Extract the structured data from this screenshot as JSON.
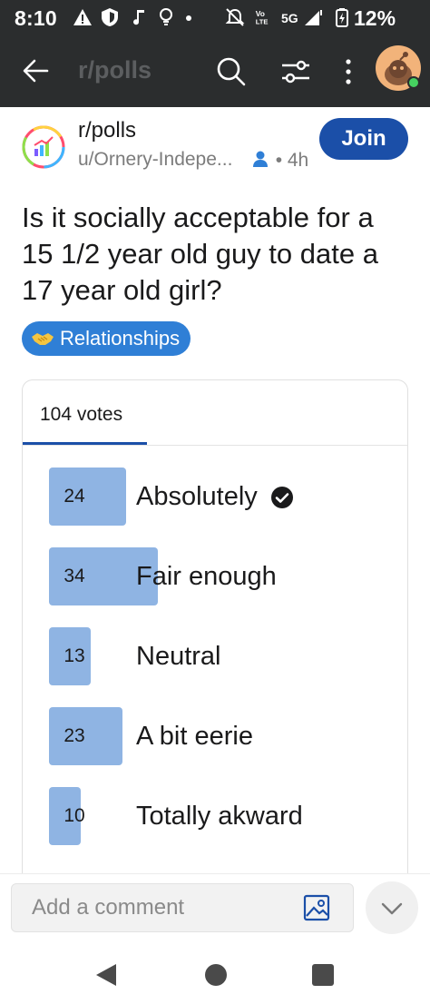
{
  "status_bar": {
    "time": "8:10",
    "network": "5G",
    "battery": "12%"
  },
  "header": {
    "title": "r/polls"
  },
  "post": {
    "subreddit": "r/polls",
    "author": "u/Ornery-Indepe...",
    "age": "4h",
    "join_label": "Join",
    "title": "Is it socially acceptable for a 15 1/2 year old guy to date a 17 year old girl?",
    "flair": "Relationships",
    "flair_color": "#2f7fd6"
  },
  "poll": {
    "votes_label": "104 votes",
    "accent": "#1b4fa8",
    "bar_color": "#8fb4e3",
    "max_votes": 34,
    "options": [
      {
        "count": "24",
        "label": "Absolutely",
        "votes": 24,
        "selected": true
      },
      {
        "count": "34",
        "label": "Fair enough",
        "votes": 34,
        "selected": false
      },
      {
        "count": "13",
        "label": "Neutral",
        "votes": 13,
        "selected": false
      },
      {
        "count": "23",
        "label": "A bit eerie",
        "votes": 23,
        "selected": false
      },
      {
        "count": "10",
        "label": "Totally akward",
        "votes": 10,
        "selected": false
      }
    ]
  },
  "comment": {
    "placeholder": "Add a comment"
  }
}
